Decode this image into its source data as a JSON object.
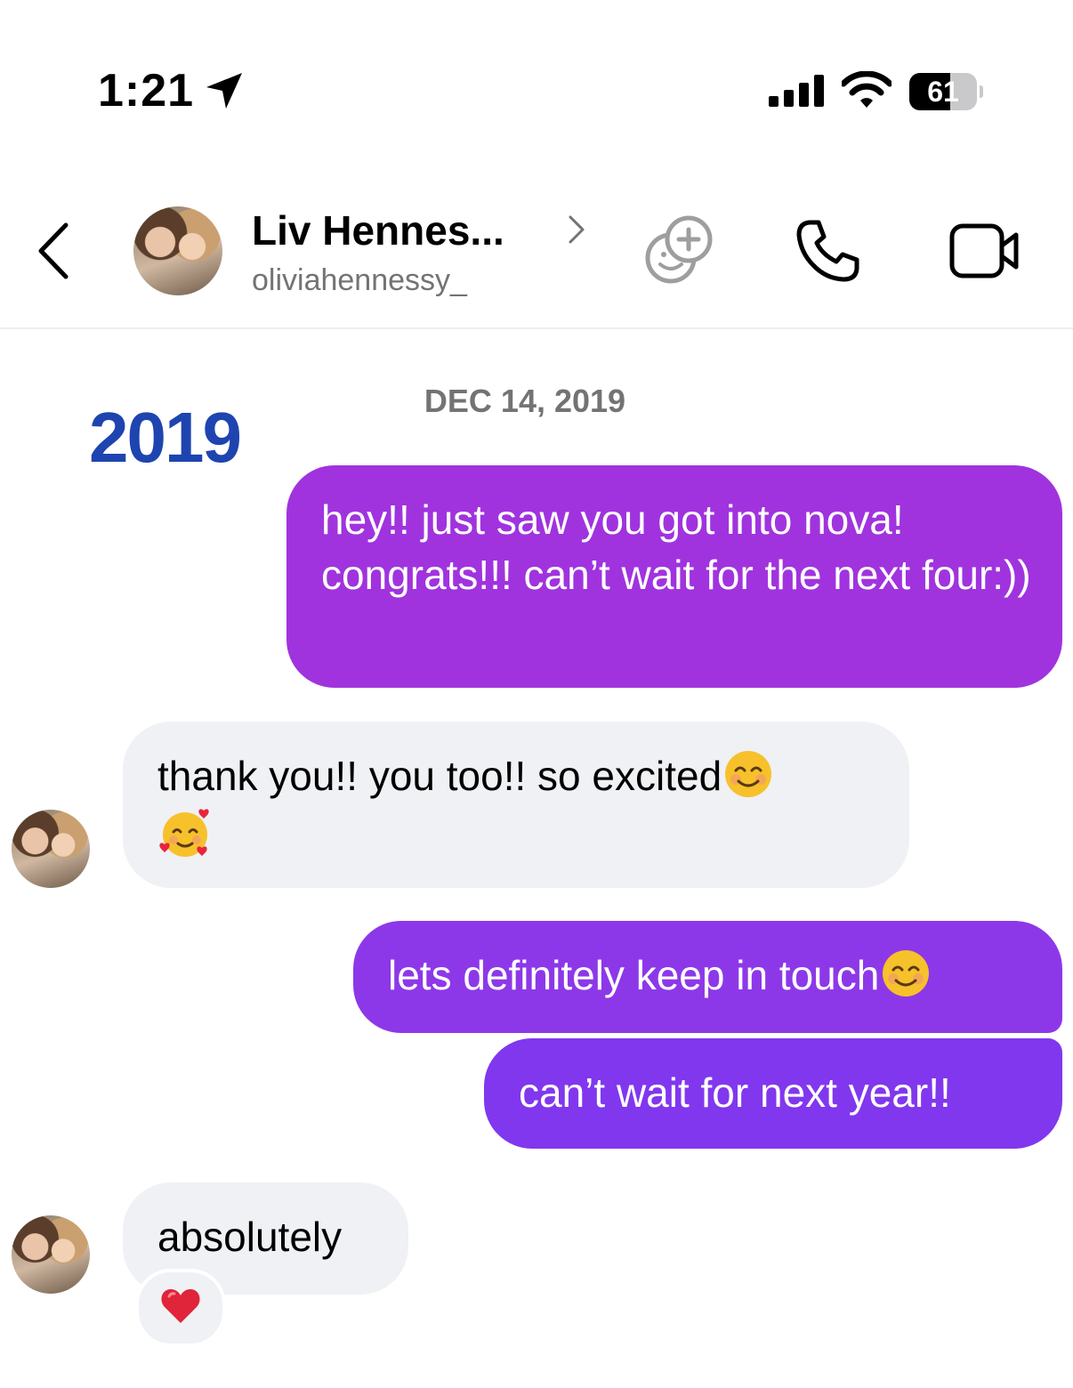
{
  "status_bar": {
    "time": "1:21",
    "battery_percent": "61",
    "battery_level": 0.61,
    "icons": [
      "location-arrow-icon",
      "cellular-signal-icon",
      "wifi-icon",
      "battery-icon"
    ]
  },
  "header": {
    "name": "Liv Hennes...",
    "username": "oliviahennessy_",
    "icons": [
      "back-chevron-icon",
      "chevron-right-icon",
      "sticker-add-icon",
      "phone-icon",
      "video-camera-icon"
    ]
  },
  "thread": {
    "year_label": "2019",
    "date_label": "DEC 14, 2019",
    "messages": [
      {
        "direction": "outgoing",
        "text": "hey!! just saw you got into nova! congrats!!! can’t wait for the next four:))"
      },
      {
        "direction": "incoming",
        "text": "thank you!! you too!! so excited",
        "emojis": [
          "smiling-face-with-smiling-eyes",
          "smiling-face-with-hearts"
        ]
      },
      {
        "direction": "outgoing",
        "text": "lets definitely keep in touch",
        "emojis": [
          "smiling-face-with-smiling-eyes"
        ]
      },
      {
        "direction": "outgoing",
        "text": "can’t wait for next year!!"
      },
      {
        "direction": "incoming",
        "text": "absolutely",
        "reaction": "red-heart"
      }
    ]
  },
  "colors": {
    "outgoing_bubble_top": "#a033de",
    "outgoing_bubble_mid": "#8d38e8",
    "outgoing_bubble_bottom": "#8137ee",
    "incoming_bubble": "#eff1f4",
    "year_label": "#1e44b0",
    "secondary_text": "#737373"
  }
}
